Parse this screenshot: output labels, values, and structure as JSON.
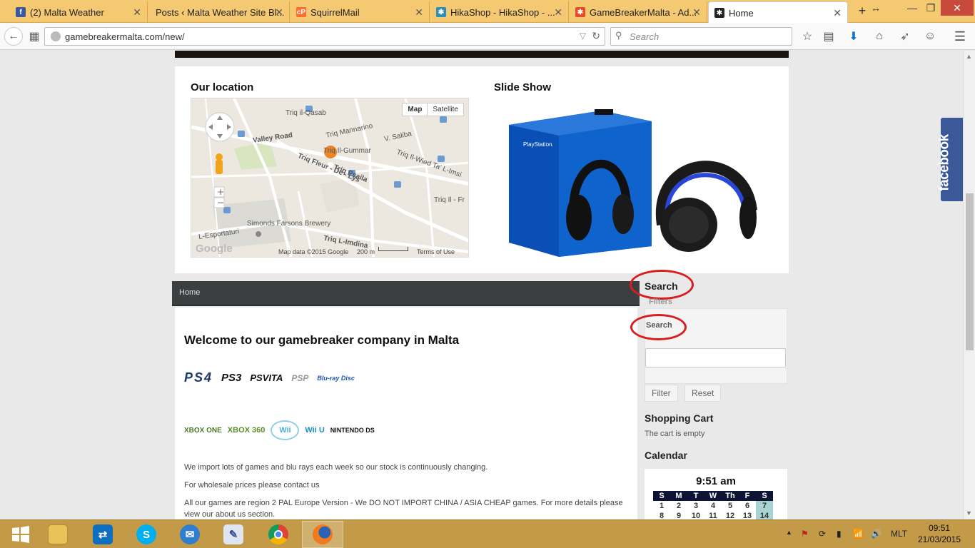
{
  "browser": {
    "tabs": [
      {
        "label": "(2) Malta Weather",
        "icon": "facebook-icon",
        "color": "#3b5998"
      },
      {
        "label": "Posts ‹ Malta Weather Site Bl...",
        "icon": "blank-icon",
        "color": "#f5c872"
      },
      {
        "label": "SquirrelMail",
        "icon": "cpanel-icon",
        "color": "#ff6c2c"
      },
      {
        "label": "HikaShop - HikaShop - ...",
        "icon": "hikashop-icon",
        "color": "#2a8fbd"
      },
      {
        "label": "GameBreakerMalta - Ad...",
        "icon": "joomla-icon",
        "color": "#e44d26"
      },
      {
        "label": "Home",
        "icon": "joomla-dark-icon",
        "color": "#222"
      }
    ],
    "url": "gamebreakermalta.com/new/",
    "search_placeholder": "Search"
  },
  "page": {
    "location_title": "Our location",
    "slideshow_title": "Slide Show",
    "map": {
      "map_btn": "Map",
      "satellite_btn": "Satellite",
      "footer_data": "Map data ©2015 Google",
      "footer_scale": "200 m",
      "footer_terms": "Terms of Use",
      "brand": "Google",
      "labels": [
        "Valley Road",
        "Triq Mannarino",
        "Triq il-Qasab",
        "Triq Il-Gummar",
        "Triq Il-Wied Ta' L-Imsi",
        "Triq Fleur - De - Lys",
        "Triq Psaila",
        "Simonds Farsons Brewery",
        "Triq L-Imdina",
        "L-Esportaturi",
        "V. Saliba",
        "Triq Il - Fr"
      ]
    },
    "breadcrumb": "Home",
    "article": {
      "title": "Welcome to our gamebreaker company in Malta",
      "logos_row1": [
        "PS4",
        "PS3",
        "PSVITA",
        "PSP",
        "Blu-ray Disc"
      ],
      "logos_row2": [
        "XBOX ONE",
        "XBOX 360",
        "Wii",
        "Wii U",
        "NINTENDO DS"
      ],
      "p1": "We import lots of games and blu rays each week so our stock is continuously changing.",
      "p2": "For wholesale prices please contact us",
      "p3": "All our games are region 2 PAL Europe Version - We DO NOT IMPORT CHINA / ASIA CHEAP games. For more details please view our about us section."
    },
    "sidebar": {
      "search_title": "Search",
      "filters_label": "Filters",
      "search_label": "Search",
      "filter_btn": "Filter",
      "reset_btn": "Reset",
      "cart_title": "Shopping Cart",
      "cart_text": "The cart is empty",
      "calendar_title": "Calendar",
      "calendar_time": "9:51 am",
      "calendar_days": [
        "S",
        "M",
        "T",
        "W",
        "Th",
        "F",
        "S"
      ],
      "calendar_rows": [
        [
          "1",
          "2",
          "3",
          "4",
          "5",
          "6",
          "7"
        ],
        [
          "8",
          "9",
          "10",
          "11",
          "12",
          "13",
          "14"
        ]
      ]
    },
    "facebook_label": "facebook"
  },
  "taskbar": {
    "apps": [
      "file-explorer-icon",
      "teamviewer-icon",
      "skype-icon",
      "thunderbird-icon",
      "notepad-icon",
      "chrome-icon",
      "firefox-icon"
    ],
    "language": "MLT",
    "time": "09:51",
    "date": "21/03/2015"
  }
}
